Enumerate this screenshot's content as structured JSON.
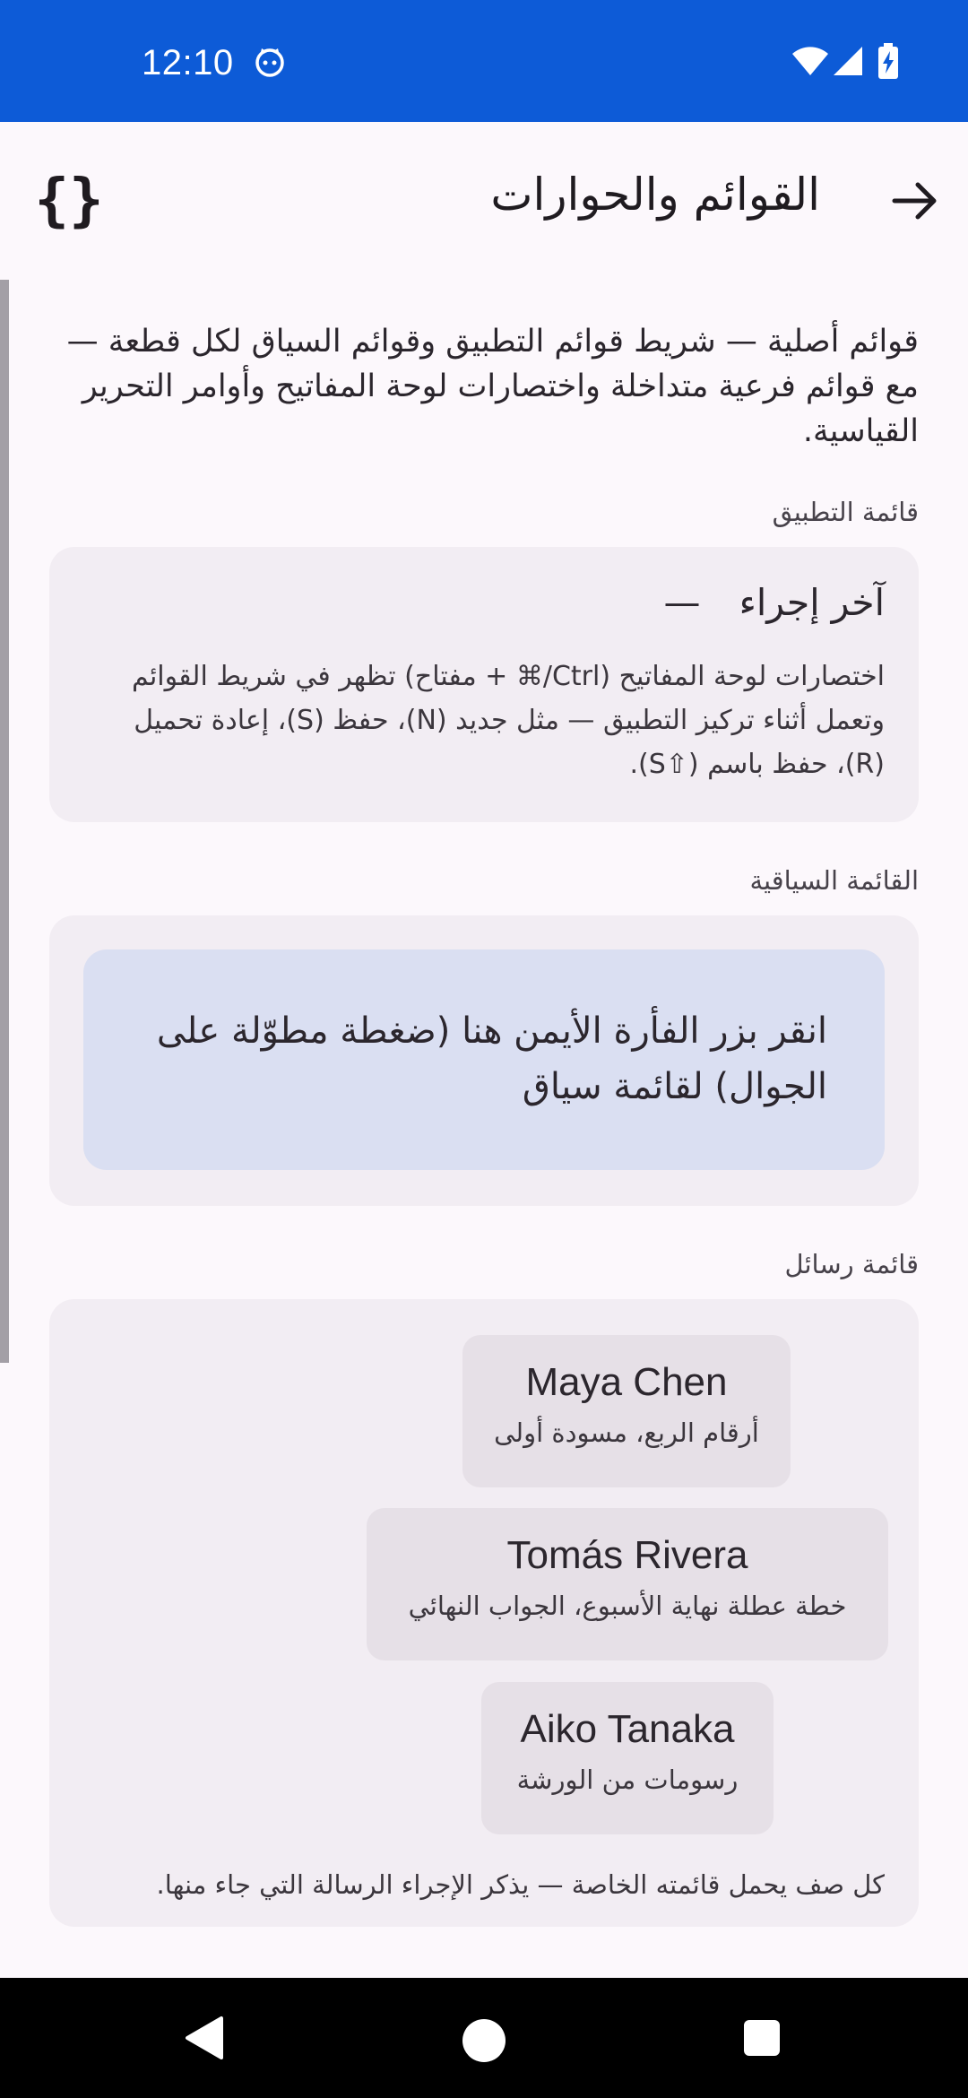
{
  "status_bar": {
    "time": "12:10",
    "bg_color": "#0D5BD7"
  },
  "app_bar": {
    "title": "القوائم والحوارات",
    "code_button_label": "{}",
    "back_icon": "arrow-right-icon"
  },
  "intro": "قوائم أصلية — شريط قوائم التطبيق وقوائم السياق لكل قطعة — مع قوائم فرعية متداخلة واختصارات لوحة المفاتيح وأوامر التحرير القياسية.",
  "app_menu": {
    "label": "قائمة التطبيق",
    "last_action_title": "آخر إجراء",
    "last_action_value": "—",
    "body": "اختصارات لوحة المفاتيح (Ctrl/⌘ + مفتاح) تظهر في شريط القوائم وتعمل أثناء تركيز التطبيق — مثل جديد (N)، حفظ (S)، إعادة تحميل (R)، حفظ باسم (⇧S)."
  },
  "context_menu": {
    "label": "القائمة السياقية",
    "area_text": "انقر بزر الفأرة الأيمن هنا (ضغطة مطوّلة على الجوال) لقائمة سياق",
    "area_color": "#DADFF2"
  },
  "message_list": {
    "label": "قائمة رسائل",
    "items": [
      {
        "name": "Maya Chen",
        "subject": "أرقام الربع، مسودة أولى"
      },
      {
        "name": "Tomás Rivera",
        "subject": "خطة عطلة نهاية الأسبوع، الجواب النهائي"
      },
      {
        "name": "Aiko Tanaka",
        "subject": "رسومات من الورشة"
      }
    ],
    "footer": "كل صف يحمل قائمته الخاصة — يذكر الإجراء الرسالة التي جاء منها."
  }
}
